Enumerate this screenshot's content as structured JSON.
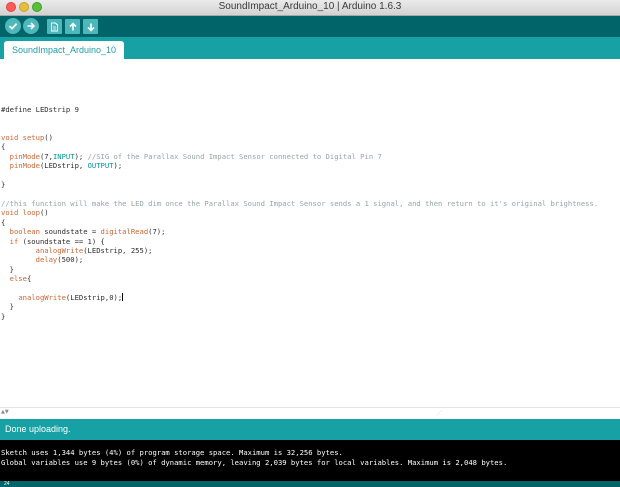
{
  "window": {
    "title": "SoundImpact_Arduino_10 | Arduino 1.6.3"
  },
  "colors": {
    "toolbar": "#006468",
    "tabbar": "#17a1a5",
    "button": "#4db7bb",
    "keyword": "#cc6633",
    "type": "#00979c",
    "comment": "#95a5a6"
  },
  "toolbar": {
    "buttons": [
      {
        "name": "verify",
        "icon": "check-icon"
      },
      {
        "name": "upload",
        "icon": "arrow-right-icon"
      },
      {
        "name": "new",
        "icon": "new-file-icon"
      },
      {
        "name": "open",
        "icon": "arrow-up-icon"
      },
      {
        "name": "save",
        "icon": "arrow-down-icon"
      }
    ]
  },
  "tabs": [
    {
      "label": "SoundImpact_Arduino_10",
      "active": true
    }
  ],
  "code": [
    [],
    [],
    [
      {
        "t": "#define LEDstrip 9"
      }
    ],
    [],
    [],
    [
      {
        "t": "void",
        "c": "kw"
      },
      {
        "t": " "
      },
      {
        "t": "setup",
        "c": "kw"
      },
      {
        "t": "()"
      }
    ],
    [
      {
        "t": "{"
      }
    ],
    [
      {
        "t": "  "
      },
      {
        "t": "pinMode",
        "c": "kw"
      },
      {
        "t": "(7,"
      },
      {
        "t": "INPUT",
        "c": "ty"
      },
      {
        "t": "); "
      },
      {
        "t": "//SIG of the Parallax Sound Impact Sensor connected to Digital Pin 7",
        "c": "cm"
      }
    ],
    [
      {
        "t": "  "
      },
      {
        "t": "pinMode",
        "c": "kw"
      },
      {
        "t": "(LEDstrip, "
      },
      {
        "t": "OUTPUT",
        "c": "ty"
      },
      {
        "t": ");"
      }
    ],
    [],
    [
      {
        "t": "}"
      }
    ],
    [],
    [
      {
        "t": "//this function will make the LED dim once the Parallax Sound Impact Sensor sends a 1 signal, and then return to it's original brightness.",
        "c": "cm"
      }
    ],
    [
      {
        "t": "void",
        "c": "kw"
      },
      {
        "t": " "
      },
      {
        "t": "loop",
        "c": "kw"
      },
      {
        "t": "()"
      }
    ],
    [
      {
        "t": "{"
      }
    ],
    [
      {
        "t": "  "
      },
      {
        "t": "boolean",
        "c": "kw"
      },
      {
        "t": " soundstate = "
      },
      {
        "t": "digitalRead",
        "c": "kw"
      },
      {
        "t": "(7);"
      }
    ],
    [
      {
        "t": "  "
      },
      {
        "t": "if",
        "c": "kw"
      },
      {
        "t": " (soundstate == 1) {"
      }
    ],
    [
      {
        "t": "        "
      },
      {
        "t": "analogWrite",
        "c": "kw"
      },
      {
        "t": "(LEDstrip, 255);"
      }
    ],
    [
      {
        "t": "        "
      },
      {
        "t": "delay",
        "c": "kw"
      },
      {
        "t": "(500);"
      }
    ],
    [
      {
        "t": "  }"
      }
    ],
    [
      {
        "t": "  "
      },
      {
        "t": "else",
        "c": "kw"
      },
      {
        "t": "{"
      }
    ],
    [],
    [
      {
        "t": "    "
      },
      {
        "t": "analogWrite",
        "c": "kw"
      },
      {
        "t": "(LEDstrip,0);"
      },
      {
        "cursor": true
      }
    ],
    [
      {
        "t": "  }"
      }
    ],
    [
      {
        "t": "}"
      }
    ]
  ],
  "status": {
    "message": "Done uploading."
  },
  "console": {
    "lines": [
      "Sketch uses 1,344 bytes (4%) of program storage space. Maximum is 32,256 bytes.",
      "Global variables use 9 bytes (0%) of dynamic memory, leaving 2,039 bytes for local variables. Maximum is 2,048 bytes."
    ]
  },
  "footer": {
    "line_number": "24"
  }
}
